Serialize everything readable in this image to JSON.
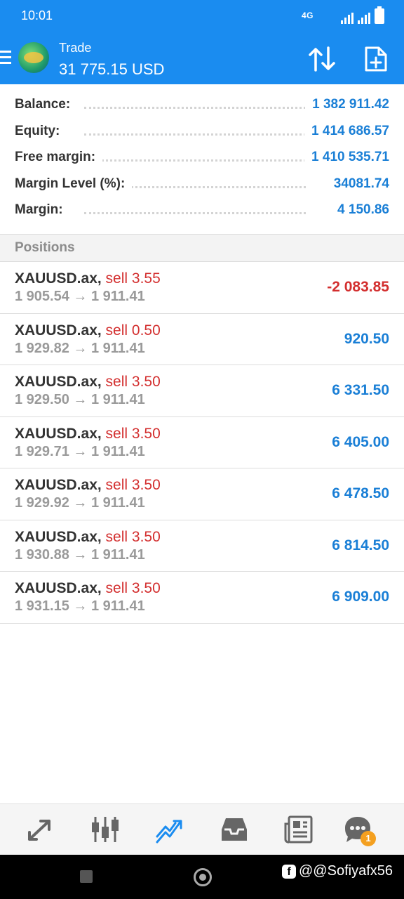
{
  "status": {
    "time": "10:01",
    "net": "4G"
  },
  "header": {
    "title": "Trade",
    "amount": "31 775.15 USD"
  },
  "summary": [
    {
      "label": "Balance:",
      "value": "1 382 911.42"
    },
    {
      "label": "Equity:",
      "value": "1 414 686.57"
    },
    {
      "label": "Free margin:",
      "value": "1 410 535.71"
    },
    {
      "label": "Margin Level (%):",
      "value": "34081.74"
    },
    {
      "label": "Margin:",
      "value": "4 150.86"
    }
  ],
  "positions_label": "Positions",
  "positions": [
    {
      "symbol": "XAUUSD.ax,",
      "side": "sell 3.55",
      "prices": "1 905.54 → 1 911.41",
      "profit": "-2 083.85"
    },
    {
      "symbol": "XAUUSD.ax,",
      "side": "sell 0.50",
      "prices": "1 929.82 → 1 911.41",
      "profit": "920.50"
    },
    {
      "symbol": "XAUUSD.ax,",
      "side": "sell 3.50",
      "prices": "1 929.50 → 1 911.41",
      "profit": "6 331.50"
    },
    {
      "symbol": "XAUUSD.ax,",
      "side": "sell 3.50",
      "prices": "1 929.71 → 1 911.41",
      "profit": "6 405.00"
    },
    {
      "symbol": "XAUUSD.ax,",
      "side": "sell 3.50",
      "prices": "1 929.92 → 1 911.41",
      "profit": "6 478.50"
    },
    {
      "symbol": "XAUUSD.ax,",
      "side": "sell 3.50",
      "prices": "1 930.88 → 1 911.41",
      "profit": "6 814.50"
    },
    {
      "symbol": "XAUUSD.ax,",
      "side": "sell 3.50",
      "prices": "1 931.15 → 1 911.41",
      "profit": "6 909.00"
    }
  ],
  "tabs": [
    {
      "name": "quotes-tab",
      "icon": "quotes-arrows-icon"
    },
    {
      "name": "chart-tab",
      "icon": "candlestick-icon"
    },
    {
      "name": "trade-tab",
      "icon": "trade-trend-icon",
      "active": true
    },
    {
      "name": "history-tab",
      "icon": "inbox-tray-icon"
    },
    {
      "name": "news-tab",
      "icon": "newspaper-icon"
    },
    {
      "name": "messages-tab",
      "icon": "chat-bubble-icon",
      "badge": "1"
    }
  ],
  "watermark": "@@Sofiyafx56",
  "colors": {
    "primary": "#1a8cf0",
    "negative": "#d32f2f",
    "positive": "#1a7fd6",
    "badge": "#f4a020"
  }
}
